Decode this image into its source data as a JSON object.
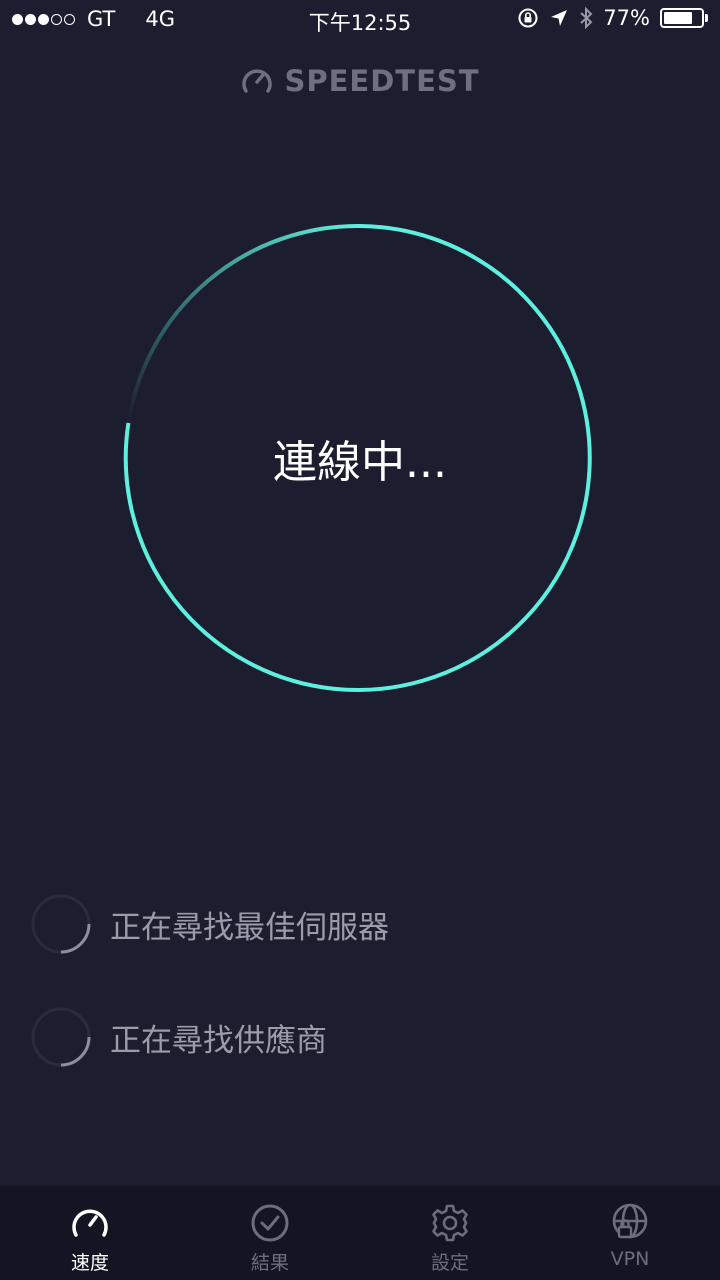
{
  "status_bar": {
    "carrier": "GT",
    "network": "4G",
    "time": "下午12:55",
    "battery_percent": "77%",
    "battery_level": 0.77
  },
  "logo": {
    "text": "SPEEDTEST",
    "icon": "speedometer-icon"
  },
  "main": {
    "status_text": "連線中...",
    "ring_color": "#5ef0de"
  },
  "progress": [
    {
      "label": "正在尋找最佳伺服器",
      "icon": "loading-spinner-icon"
    },
    {
      "label": "正在尋找供應商",
      "icon": "loading-spinner-icon"
    }
  ],
  "tabs": [
    {
      "label": "速度",
      "icon": "speedometer-icon",
      "active": true
    },
    {
      "label": "結果",
      "icon": "check-circle-icon",
      "active": false
    },
    {
      "label": "設定",
      "icon": "gear-icon",
      "active": false
    },
    {
      "label": "VPN",
      "icon": "globe-lock-icon",
      "active": false
    }
  ],
  "colors": {
    "background": "#1c1d2f",
    "tab_bar": "#141523",
    "accent": "#5ef0de"
  }
}
